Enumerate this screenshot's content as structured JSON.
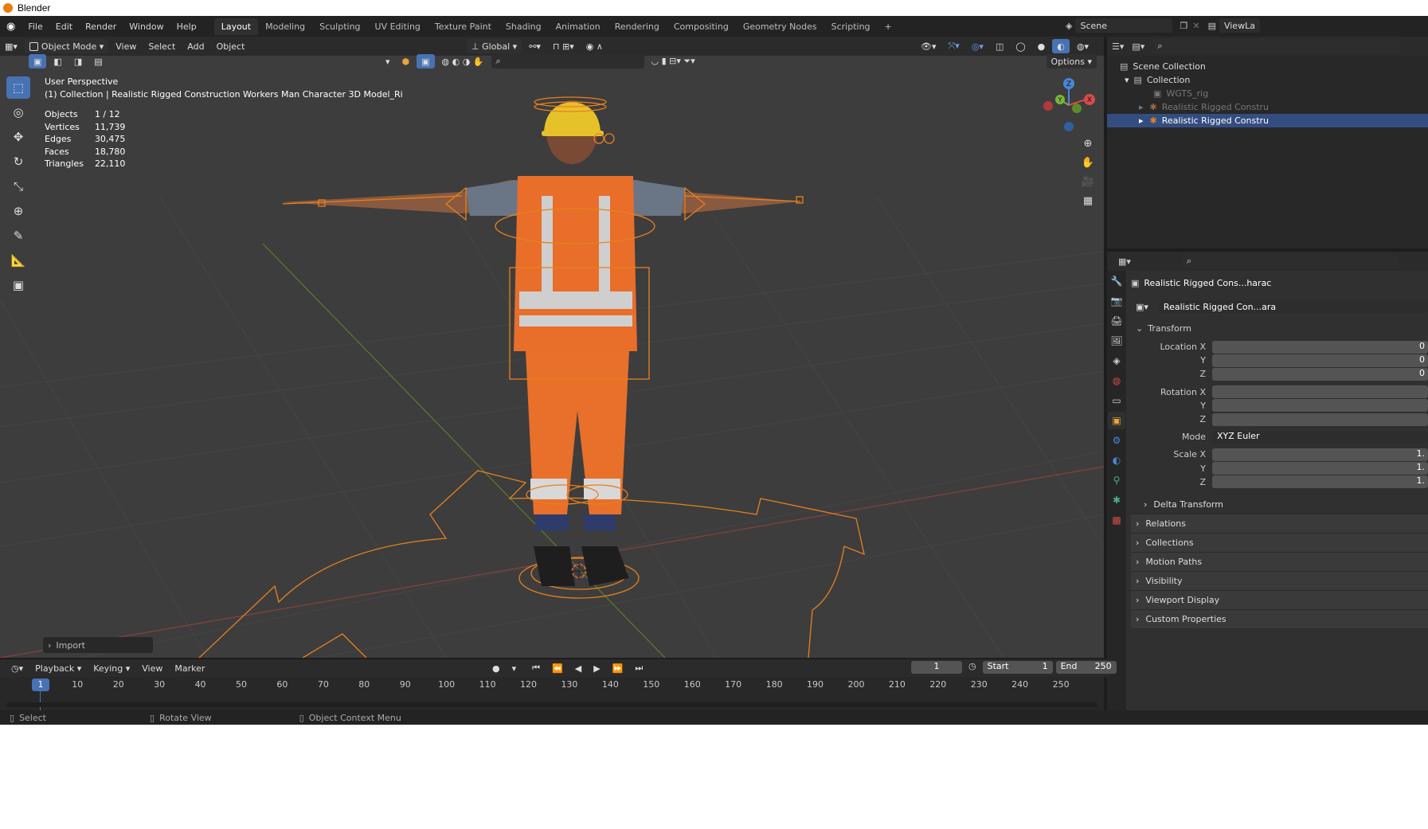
{
  "window": {
    "title": "Blender"
  },
  "menu": {
    "items": [
      "File",
      "Edit",
      "Render",
      "Window",
      "Help"
    ]
  },
  "workspaces": {
    "tabs": [
      "Layout",
      "Modeling",
      "Sculpting",
      "UV Editing",
      "Texture Paint",
      "Shading",
      "Animation",
      "Rendering",
      "Compositing",
      "Geometry Nodes",
      "Scripting"
    ],
    "active": "Layout",
    "add": "+"
  },
  "scene": {
    "name": "Scene",
    "view_layer": "ViewLa"
  },
  "viewport": {
    "mode": "Object Mode",
    "menus": [
      "View",
      "Select",
      "Add",
      "Object"
    ],
    "orientation": "Global",
    "options": "Options",
    "perspective": "User Perspective",
    "collection_info": "(1) Collection | Realistic Rigged Construction Workers Man Character 3D Model_Ri",
    "stats": [
      {
        "label": "Objects",
        "value": "1 / 12"
      },
      {
        "label": "Vertices",
        "value": "11,739"
      },
      {
        "label": "Edges",
        "value": "30,475"
      },
      {
        "label": "Faces",
        "value": "18,780"
      },
      {
        "label": "Triangles",
        "value": "22,110"
      }
    ],
    "import_panel": "Import",
    "gizmo": {
      "z": "Z",
      "y": "Y",
      "x": "X"
    }
  },
  "outliner": {
    "rows": [
      {
        "label": "Scene Collection",
        "indent": 0,
        "selected": false
      },
      {
        "label": "Collection",
        "indent": 1,
        "selected": false
      },
      {
        "label": "WGTS_rig",
        "indent": 2,
        "selected": false
      },
      {
        "label": "Realistic Rigged Constru",
        "indent": 2,
        "selected": false
      },
      {
        "label": "Realistic Rigged Constru",
        "indent": 2,
        "selected": true
      }
    ]
  },
  "properties": {
    "object_name": "Realistic Rigged Cons...harac",
    "data_name": "Realistic Rigged Con...ara",
    "transform_title": "Transform",
    "location": {
      "label": "Location X",
      "x": "0",
      "y": "0",
      "z": "0"
    },
    "rotation": {
      "label": "Rotation X",
      "x": "",
      "y": "",
      "z": ""
    },
    "mode": {
      "label": "Mode",
      "value": "XYZ Euler"
    },
    "scale": {
      "label": "Scale X",
      "x": "1.",
      "y": "1.",
      "z": "1."
    },
    "axis_y": "Y",
    "axis_z": "Z",
    "panels": [
      "Delta Transform",
      "Relations",
      "Collections",
      "Motion Paths",
      "Visibility",
      "Viewport Display",
      "Custom Properties"
    ]
  },
  "timeline": {
    "menus": [
      "Playback",
      "Keying",
      "View",
      "Marker"
    ],
    "current_frame": "1",
    "start_label": "Start",
    "start": "1",
    "end_label": "End",
    "end": "250",
    "ruler": [
      "1",
      "10",
      "20",
      "30",
      "40",
      "50",
      "60",
      "70",
      "80",
      "90",
      "100",
      "110",
      "120",
      "130",
      "140",
      "150",
      "160",
      "170",
      "180",
      "190",
      "200",
      "210",
      "220",
      "230",
      "240",
      "250"
    ]
  },
  "statusbar": {
    "items": [
      "Select",
      "Rotate View",
      "Object Context Menu"
    ]
  },
  "colors": {
    "accent": "#4772b3",
    "rig": "#e8801e",
    "selected_row": "#334d80"
  }
}
